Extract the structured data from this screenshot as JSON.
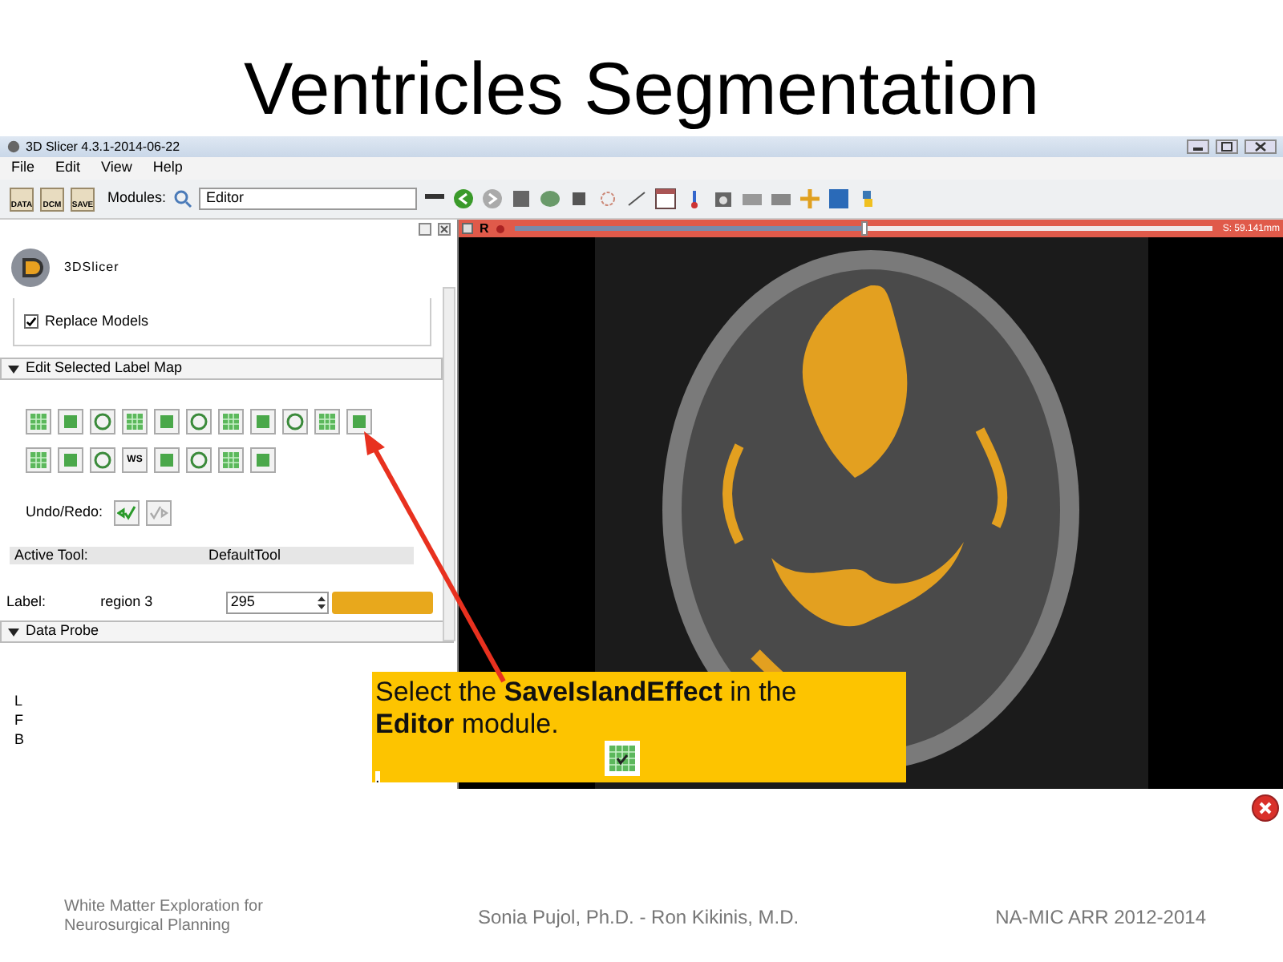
{
  "slide_title": "Ventricles Segmentation",
  "window": {
    "title": "3D Slicer 4.3.1-2014-06-22"
  },
  "menu": [
    "File",
    "Edit",
    "View",
    "Help"
  ],
  "toolbar": {
    "data_button": "DATA",
    "dcm_button": "DCM",
    "save_button": "SAVE",
    "modules_label": "Modules:",
    "module_select": "Editor"
  },
  "panel": {
    "logo_text": "3DSlicer",
    "replace_models": {
      "label": "Replace Models",
      "checked": true
    },
    "edit_section": {
      "title": "Edit Selected Label Map",
      "expanded": true
    },
    "ws_tool": "WS",
    "undo_label": "Undo/Redo:",
    "active_tool": {
      "label": "Active Tool:",
      "value": "DefaultTool"
    },
    "label_row": {
      "label": "Label:",
      "name": "region 3",
      "value": "295",
      "color": "#e8a81c"
    },
    "probe_section": {
      "title": "Data Probe",
      "expanded": true
    },
    "probe_lines": [
      "L",
      "F",
      "B"
    ]
  },
  "viewer": {
    "orientation": "R",
    "slider": {
      "level": 0.5
    },
    "reading": "S: 59.141mm"
  },
  "callout": {
    "text": "Select the **SaveIslandEffect** in the **Editor** module.",
    "note": "."
  },
  "footer": {
    "left": "White Matter Exploration for Neurosurgical Planning",
    "center": "Sonia Pujol, Ph.D. - Ron Kikinis, M.D.",
    "right": "NA-MIC ARR 2012-2014"
  }
}
